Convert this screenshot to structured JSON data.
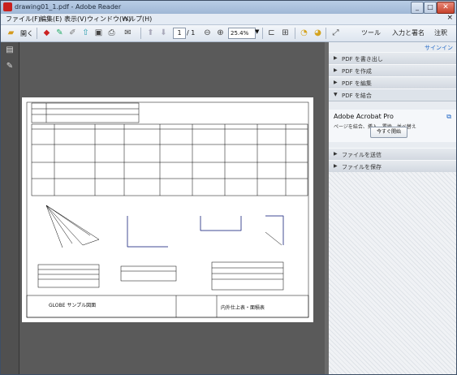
{
  "window": {
    "title": "drawing01_1.pdf - Adobe Reader"
  },
  "menubar": {
    "items": [
      "ファイル(F)",
      "編集(E)",
      "表示(V)",
      "ウィンドウ(W)",
      "ヘルプ(H)"
    ],
    "close": "×"
  },
  "toolbar": {
    "open_label": "開く",
    "page_current": "1",
    "page_total": "/ 1",
    "zoom": "25.4%",
    "tools": "ツール",
    "input_sign": "入力と署名",
    "comment": "注釈"
  },
  "sidepane": {
    "sign_in": "サインイン",
    "sections": [
      {
        "label": "PDF を書き出し",
        "expanded": false
      },
      {
        "label": "PDF を作成",
        "expanded": false
      },
      {
        "label": "PDF を編集",
        "expanded": false
      },
      {
        "label": "PDF を結合",
        "expanded": true
      },
      {
        "label": "ファイルを送信",
        "expanded": false
      },
      {
        "label": "ファイルを保存",
        "expanded": false
      }
    ],
    "acrobat": {
      "heading": "Adobe Acrobat Pro",
      "desc": "ページを結合、挿入、置換、並べ替え",
      "start": "今すぐ開始"
    }
  },
  "document": {
    "title_block_left": "GLOBE サンプル図面",
    "title_block_right": "内外仕上表・面積表"
  }
}
